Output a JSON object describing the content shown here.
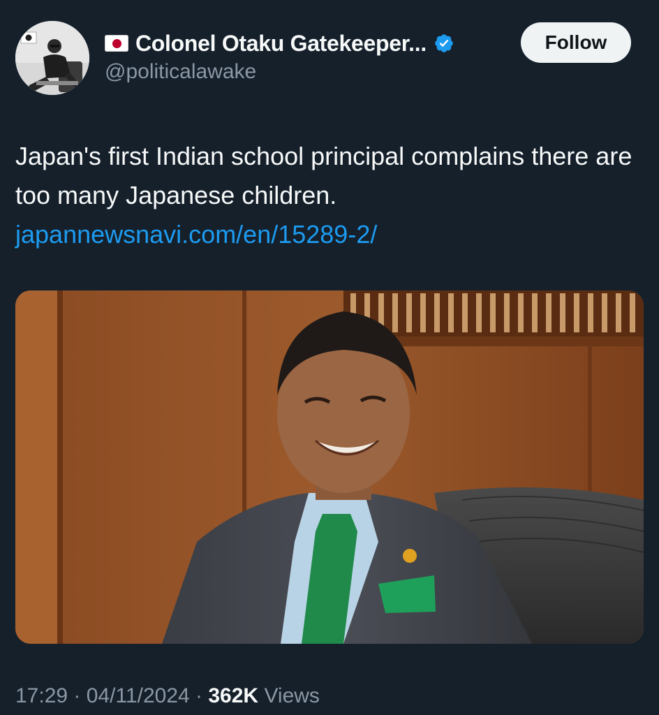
{
  "author": {
    "display_name": "Colonel Otaku Gatekeeper...",
    "handle": "@politicalawake",
    "flag_icon": "japan-flag-icon",
    "verified_icon": "verified-badge-icon",
    "verified_color": "#1d9bf0"
  },
  "follow_button": {
    "label": "Follow"
  },
  "tweet": {
    "text": "Japan's first Indian school principal complains there are too many Japanese children.",
    "link": "japannewsnavi.com/en/15289-2/"
  },
  "meta": {
    "time": "17:29",
    "separator": "·",
    "date": "04/11/2024",
    "views_count": "362K",
    "views_label": "Views"
  },
  "colors": {
    "background": "#15202b",
    "text": "#f7f9f9",
    "secondary": "#8b98a5",
    "link": "#1d9bf0",
    "button_bg": "#eff3f4"
  }
}
